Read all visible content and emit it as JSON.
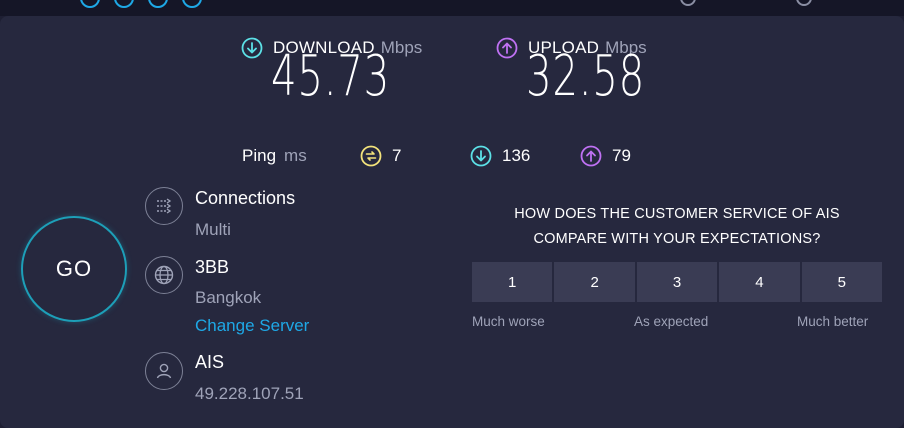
{
  "download": {
    "label": "DOWNLOAD",
    "unit": "Mbps",
    "value": "45.73",
    "icon": "download-arrow-icon",
    "color": "#5ce0e6"
  },
  "upload": {
    "label": "UPLOAD",
    "unit": "Mbps",
    "value": "32.58",
    "icon": "upload-arrow-icon",
    "color": "#bf71f3"
  },
  "ping": {
    "label": "Ping",
    "unit": "ms",
    "idle": {
      "value": "7",
      "icon": "ping-idle-icon",
      "color": "#f3e37b"
    },
    "download": {
      "value": "136",
      "icon": "ping-download-icon",
      "color": "#5ce0e6"
    },
    "upload": {
      "value": "79",
      "icon": "ping-upload-icon",
      "color": "#bf71f3"
    }
  },
  "go_button": {
    "label": "GO"
  },
  "connections": {
    "title": "Connections",
    "value": "Multi",
    "icon": "connections-icon"
  },
  "server": {
    "name": "3BB",
    "location": "Bangkok",
    "change_label": "Change Server",
    "icon": "globe-icon"
  },
  "provider": {
    "name": "AIS",
    "ip": "49.228.107.51",
    "icon": "user-icon"
  },
  "survey": {
    "question_line1": "HOW DOES THE CUSTOMER SERVICE OF AIS",
    "question_line2": "COMPARE WITH YOUR EXPECTATIONS?",
    "options": [
      "1",
      "2",
      "3",
      "4",
      "5"
    ],
    "scale_low": "Much worse",
    "scale_mid": "As expected",
    "scale_high": "Much better"
  },
  "colors": {
    "background": "#1e1f33",
    "panel": "#26283e",
    "accent": "#1ea8e6",
    "button": "#3a3c54"
  }
}
